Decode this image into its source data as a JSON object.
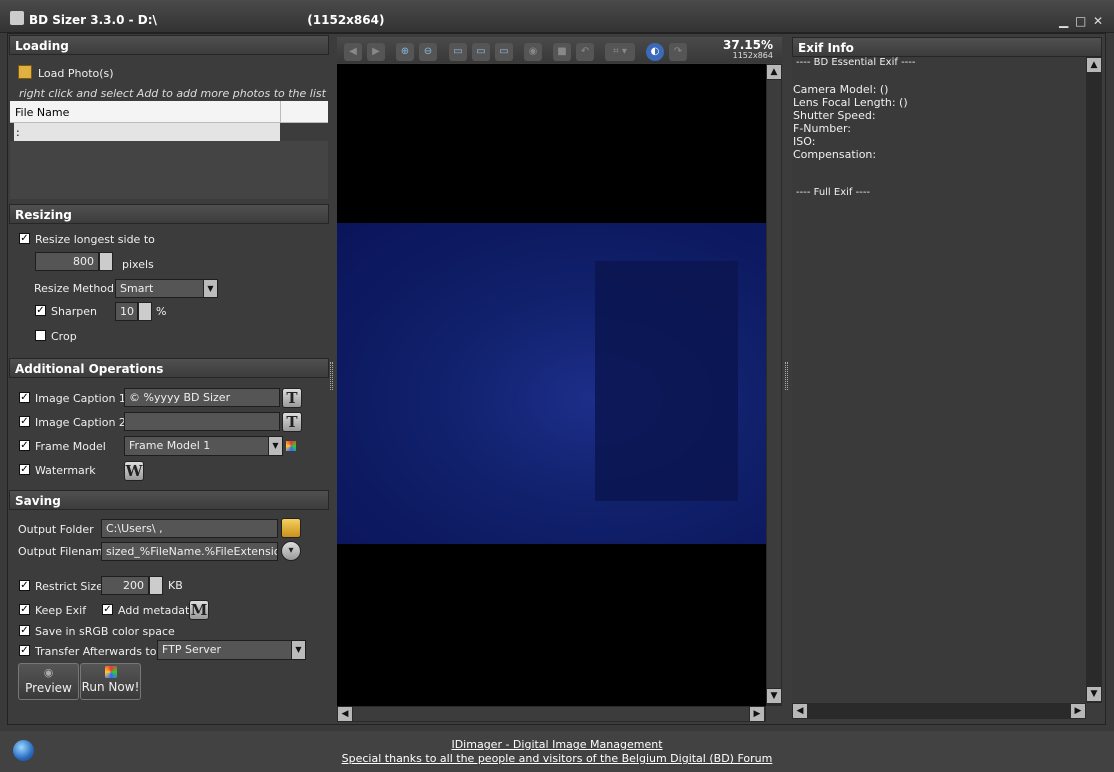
{
  "window": {
    "title": "BD Sizer 3.3.0 - D:\\                                    (1152x864)",
    "minimize": "▁",
    "maximize": "□",
    "close": "✕"
  },
  "loading": {
    "header": "Loading",
    "load_label": "Load Photo(s)",
    "hint": "right click and select Add to add more photos to the list",
    "column_filename": "File Name",
    "rows": [
      ":"
    ]
  },
  "resizing": {
    "header": "Resizing",
    "resize_longest_label": "Resize longest side to",
    "resize_longest_checked": true,
    "size_value": "800",
    "size_unit": "pixels",
    "method_label": "Resize Method",
    "method_value": "Smart",
    "sharpen_label": "Sharpen",
    "sharpen_checked": true,
    "sharpen_value": "10",
    "sharpen_unit": "%",
    "crop_label": "Crop",
    "crop_checked": false
  },
  "additional": {
    "header": "Additional Operations",
    "caption1_label": "Image Caption 1",
    "caption1_value": "© %yyyy BD Sizer",
    "caption2_label": "Image Caption 2",
    "caption2_value": "",
    "frame_label": "Frame Model",
    "frame_value": "Frame Model 1",
    "watermark_label": "Watermark",
    "t_icon": "T",
    "w_icon": "W"
  },
  "saving": {
    "header": "Saving",
    "output_folder_label": "Output Folder",
    "output_folder_value": "C:\\Users\\      ,",
    "output_filename_label": "Output Filename",
    "output_filename_value": "sized_%FileName.%FileExtension",
    "restrict_label": "Restrict Size",
    "restrict_value": "200",
    "restrict_unit": "KB",
    "keep_exif_label": "Keep Exif",
    "add_metadata_label": "Add metadata",
    "m_icon": "M",
    "srgb_label": "Save in sRGB color space",
    "transfer_label": "Transfer Afterwards to",
    "transfer_value": "FTP Server",
    "preview_label": "Preview",
    "run_label": "Run Now!"
  },
  "viewer": {
    "zoom": "37.15%",
    "dimensions": "1152x864"
  },
  "exif": {
    "header": "Exif Info",
    "essential_header": "---- BD Essential Exif ----",
    "camera_model": "Camera Model:  ()",
    "focal_length": "Lens Focal Length:  ()",
    "shutter": "Shutter Speed:",
    "fnumber": "F-Number:",
    "iso": "ISO:",
    "compensation": "Compensation:",
    "full_header": "---- Full Exif ----"
  },
  "footer": {
    "link1": "IDimager - Digital Image Management",
    "link2": "Special thanks to all the people and visitors of the Belgium Digital (BD) Forum"
  }
}
